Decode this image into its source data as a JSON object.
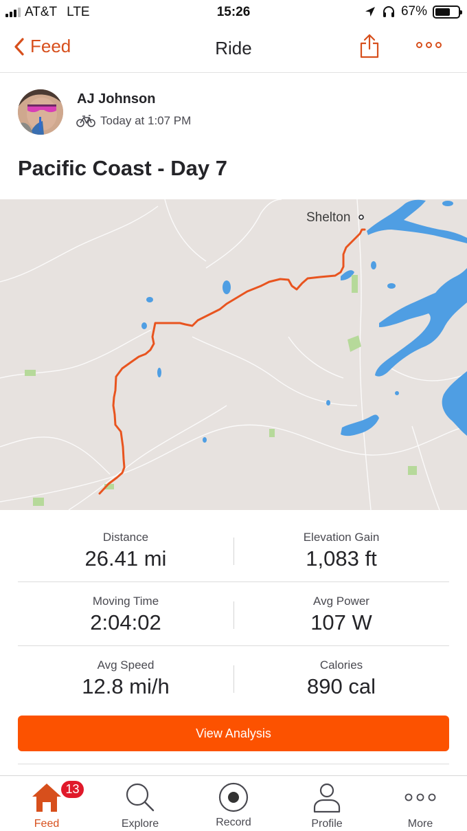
{
  "status_bar": {
    "carrier": "AT&T",
    "network": "LTE",
    "time": "15:26",
    "battery": "67%",
    "battery_level": 0.67,
    "icons": [
      "signal-icon",
      "location-arrow-icon",
      "headphones-icon",
      "battery-icon"
    ]
  },
  "nav": {
    "back_label": "Feed",
    "title": "Ride",
    "icons": [
      "chevron-left-icon",
      "share-icon",
      "more-icon"
    ]
  },
  "activity": {
    "athlete": "AJ Johnson",
    "timestamp": "Today at 1:07 PM",
    "sport_icon": "bike-icon",
    "title": "Pacific Coast - Day 7"
  },
  "map": {
    "place_label": "Shelton",
    "route_color": "#e8541f",
    "water_color": "#4f9ee3",
    "park_color": "#b6d99a"
  },
  "stats": [
    [
      {
        "label": "Distance",
        "value": "26.41 mi"
      },
      {
        "label": "Elevation Gain",
        "value": "1,083 ft"
      }
    ],
    [
      {
        "label": "Moving Time",
        "value": "2:04:02"
      },
      {
        "label": "Avg Power",
        "value": "107 W"
      }
    ],
    [
      {
        "label": "Avg Speed",
        "value": "12.8 mi/h"
      },
      {
        "label": "Calories",
        "value": "890 cal"
      }
    ]
  ],
  "analysis_button": "View Analysis",
  "tabs": [
    {
      "label": "Feed",
      "icon": "home-icon",
      "badge": "13",
      "active": true
    },
    {
      "label": "Explore",
      "icon": "search-icon"
    },
    {
      "label": "Record",
      "icon": "record-icon"
    },
    {
      "label": "Profile",
      "icon": "profile-icon"
    },
    {
      "label": "More",
      "icon": "more-icon"
    }
  ],
  "colors": {
    "brand": "#fc5200",
    "accent_text": "#d74f1c",
    "badge": "#e0192a"
  }
}
